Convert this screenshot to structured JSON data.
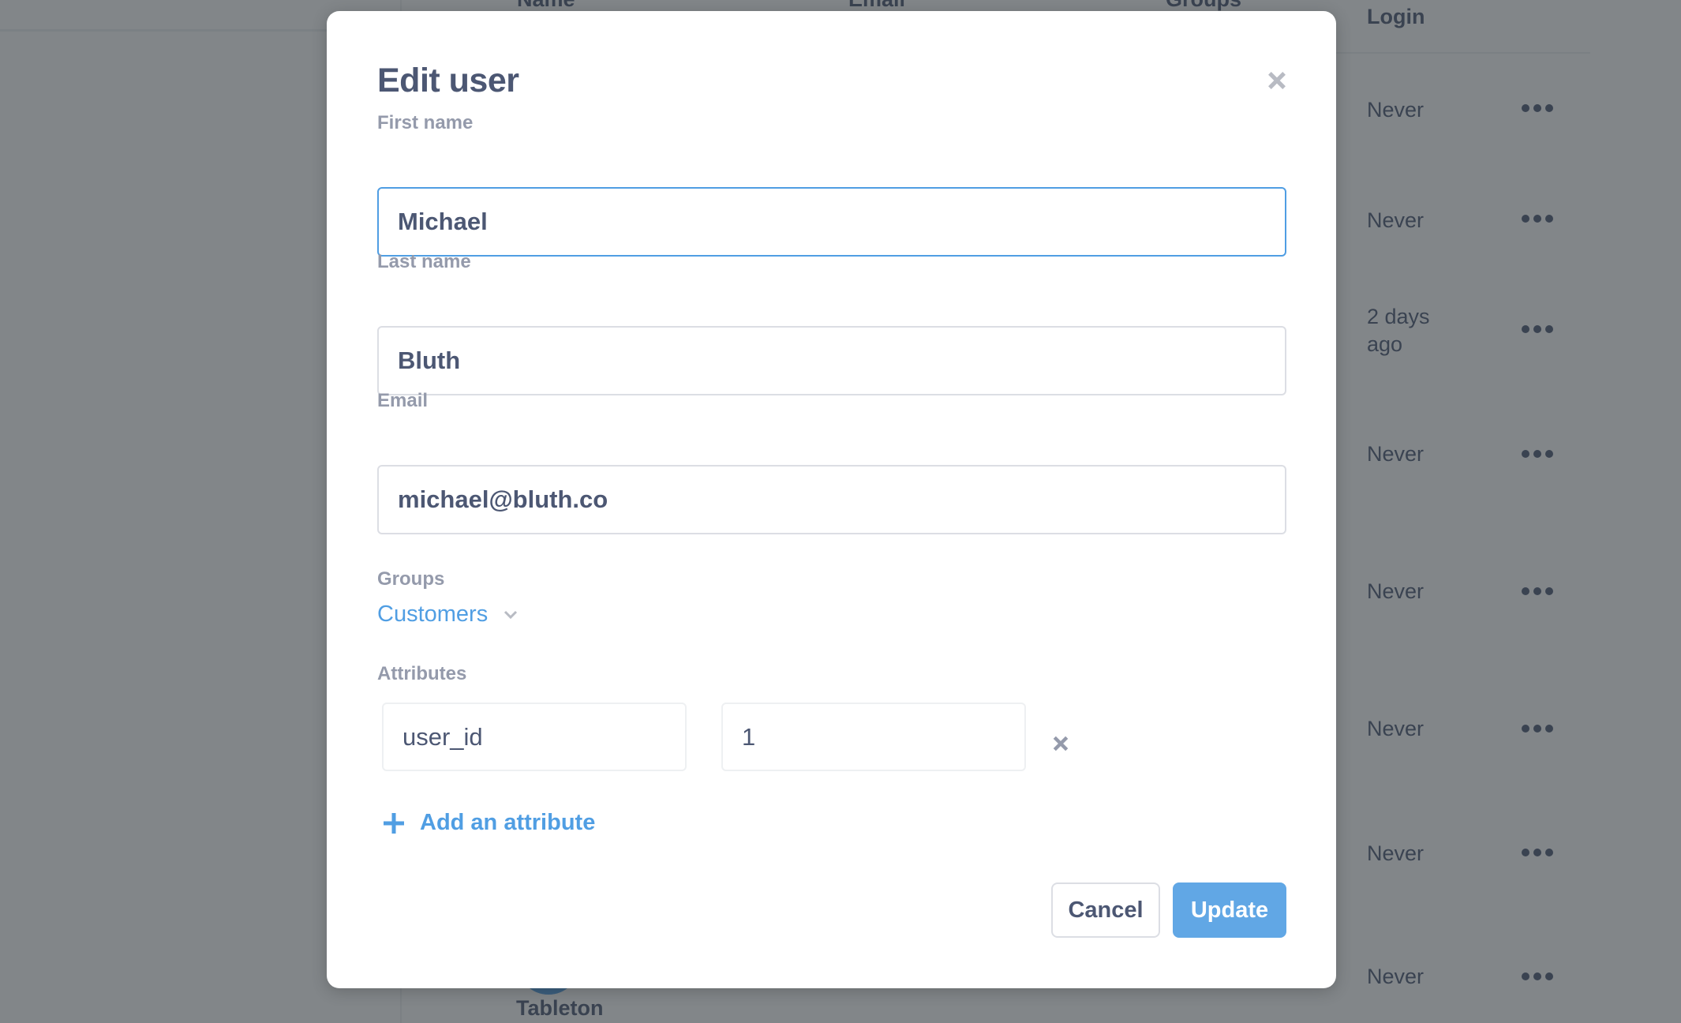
{
  "background": {
    "columns": {
      "name": "Name",
      "email": "Email",
      "groups": "Groups",
      "login": "Login"
    },
    "rows": [
      {
        "login": "Never"
      },
      {
        "login": "Never"
      },
      {
        "login": "2 days ago",
        "login_line1": "2 days",
        "login_line2": "ago"
      },
      {
        "login": "Never"
      },
      {
        "login": "Never"
      },
      {
        "login": "Never"
      },
      {
        "login": "Never"
      },
      {
        "login": "Never",
        "name_partial": "Tableton"
      }
    ]
  },
  "modal": {
    "title": "Edit user",
    "close_icon": "close-icon",
    "fields": {
      "first_name": {
        "label": "First name",
        "value": "Michael"
      },
      "last_name": {
        "label": "Last name",
        "value": "Bluth"
      },
      "email": {
        "label": "Email",
        "value": "michael@bluth.co"
      }
    },
    "groups": {
      "label": "Groups",
      "selected": "Customers",
      "icon": "chevron-down-icon"
    },
    "attributes": {
      "label": "Attributes",
      "items": [
        {
          "key": "user_id",
          "value": "1"
        }
      ],
      "add_label": "Add an attribute",
      "remove_icon": "close-icon",
      "add_icon": "plus-icon"
    },
    "buttons": {
      "cancel": "Cancel",
      "update": "Update"
    }
  },
  "colors": {
    "accent": "#509ee3",
    "text": "#4c5773",
    "label": "#949aab",
    "border": "#dcdee4"
  }
}
